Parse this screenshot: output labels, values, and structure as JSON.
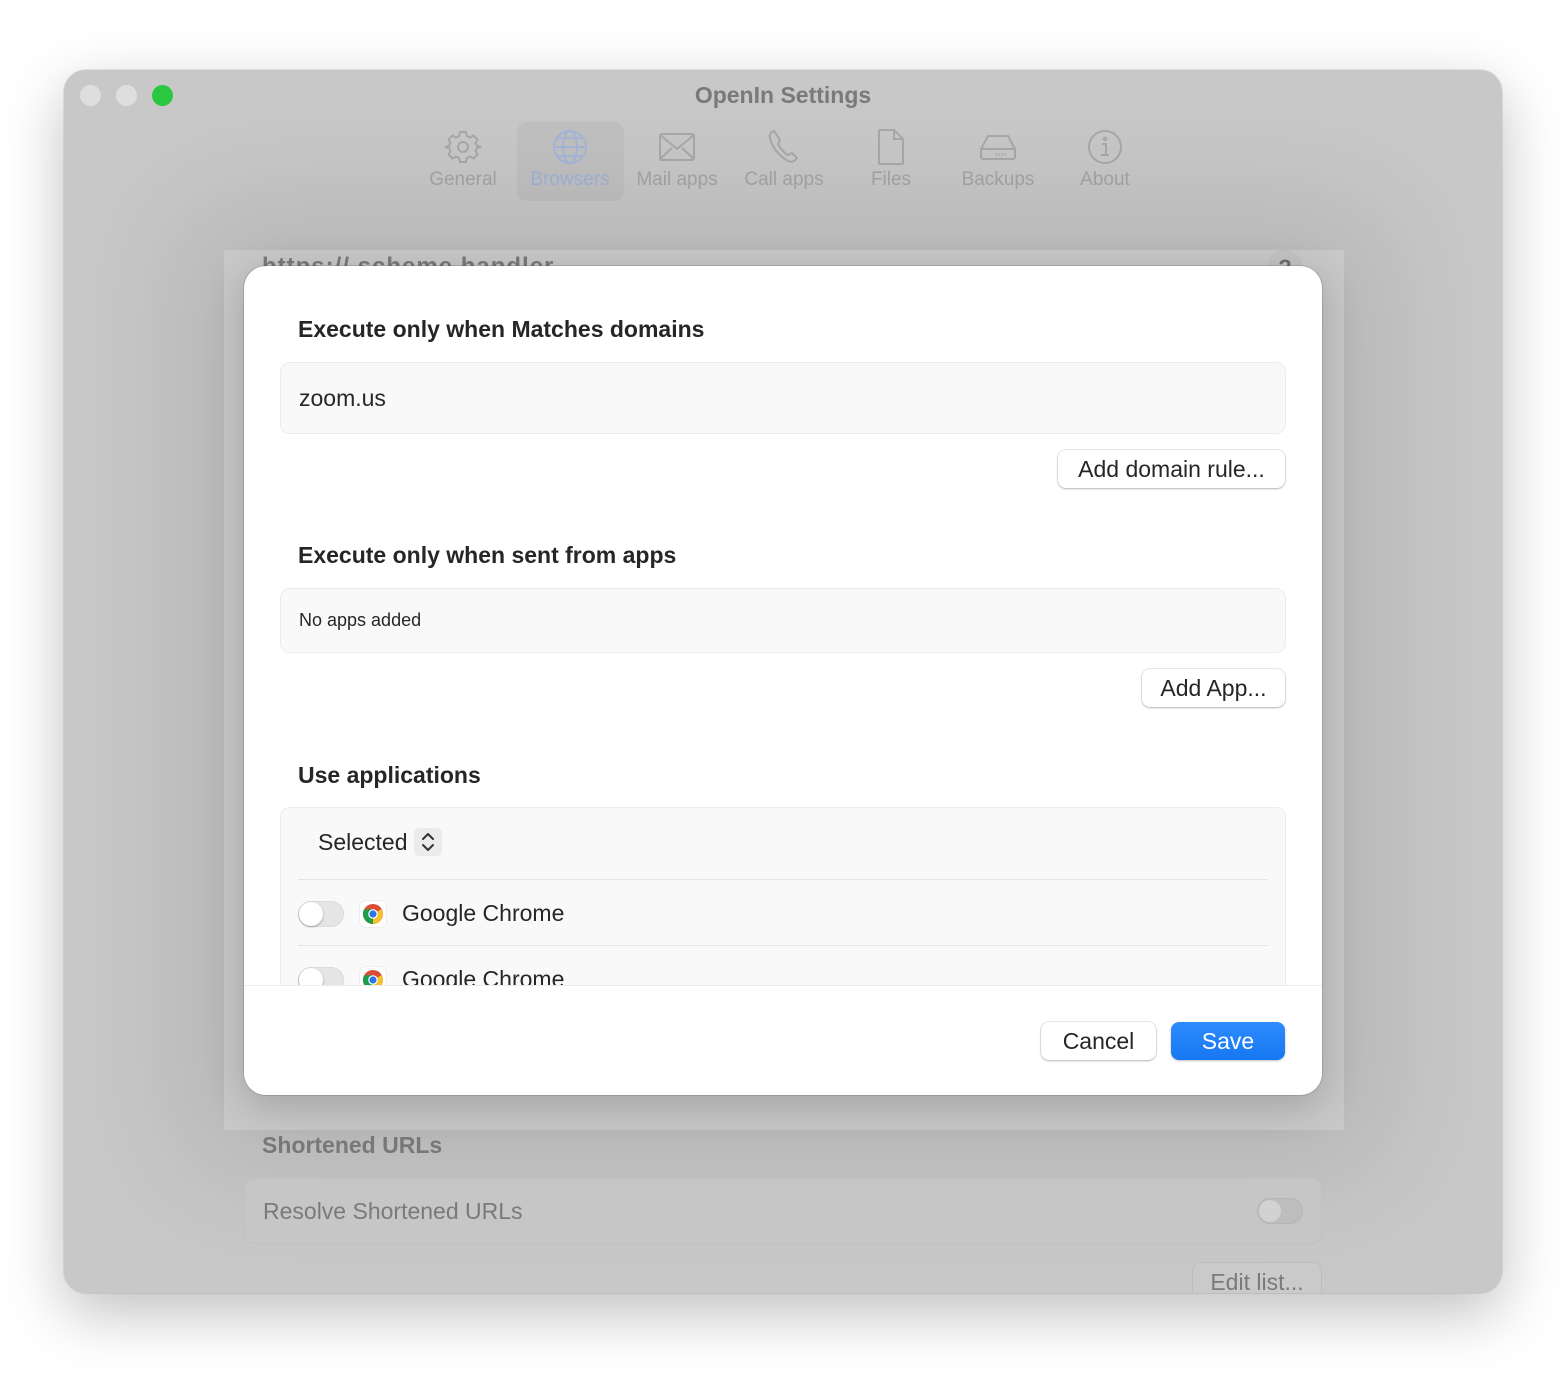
{
  "window": {
    "title": "OpenIn Settings",
    "traffic_lights": [
      "close",
      "minimize",
      "zoom"
    ]
  },
  "toolbar": {
    "items": [
      {
        "label": "General",
        "icon": "gear-icon",
        "active": false
      },
      {
        "label": "Browsers",
        "icon": "globe-icon",
        "active": true
      },
      {
        "label": "Mail apps",
        "icon": "envelope-icon",
        "active": false
      },
      {
        "label": "Call apps",
        "icon": "phone-icon",
        "active": false
      },
      {
        "label": "Files",
        "icon": "document-icon",
        "active": false
      },
      {
        "label": "Backups",
        "icon": "drive-icon",
        "active": false
      },
      {
        "label": "About",
        "icon": "info-icon",
        "active": false
      }
    ]
  },
  "background": {
    "scheme_heading": "https:// scheme handler",
    "help_label": "?",
    "shortened_section_title": "Shortened URLs",
    "resolve_label": "Resolve Shortened URLs",
    "resolve_enabled": false,
    "edit_list_label": "Edit list..."
  },
  "sheet": {
    "domains": {
      "title": "Execute only when Matches domains",
      "items": [
        "zoom.us"
      ],
      "add_button": "Add domain rule..."
    },
    "apps": {
      "title": "Execute only when sent from apps",
      "empty_text": "No apps added",
      "add_button": "Add App..."
    },
    "applications": {
      "title": "Use applications",
      "mode_selected": "Selected",
      "list": [
        {
          "name": "Google Chrome",
          "enabled": false,
          "icon": "chrome-icon"
        },
        {
          "name": "Google Chrome",
          "enabled": false,
          "icon": "chrome-icon"
        }
      ]
    },
    "footer": {
      "cancel": "Cancel",
      "save": "Save"
    }
  },
  "colors": {
    "accent": "#1a7cf5",
    "traffic_green": "#29c840",
    "window_dimmed_bg": "#c8c8c8",
    "sheet_bg": "#ffffff"
  }
}
